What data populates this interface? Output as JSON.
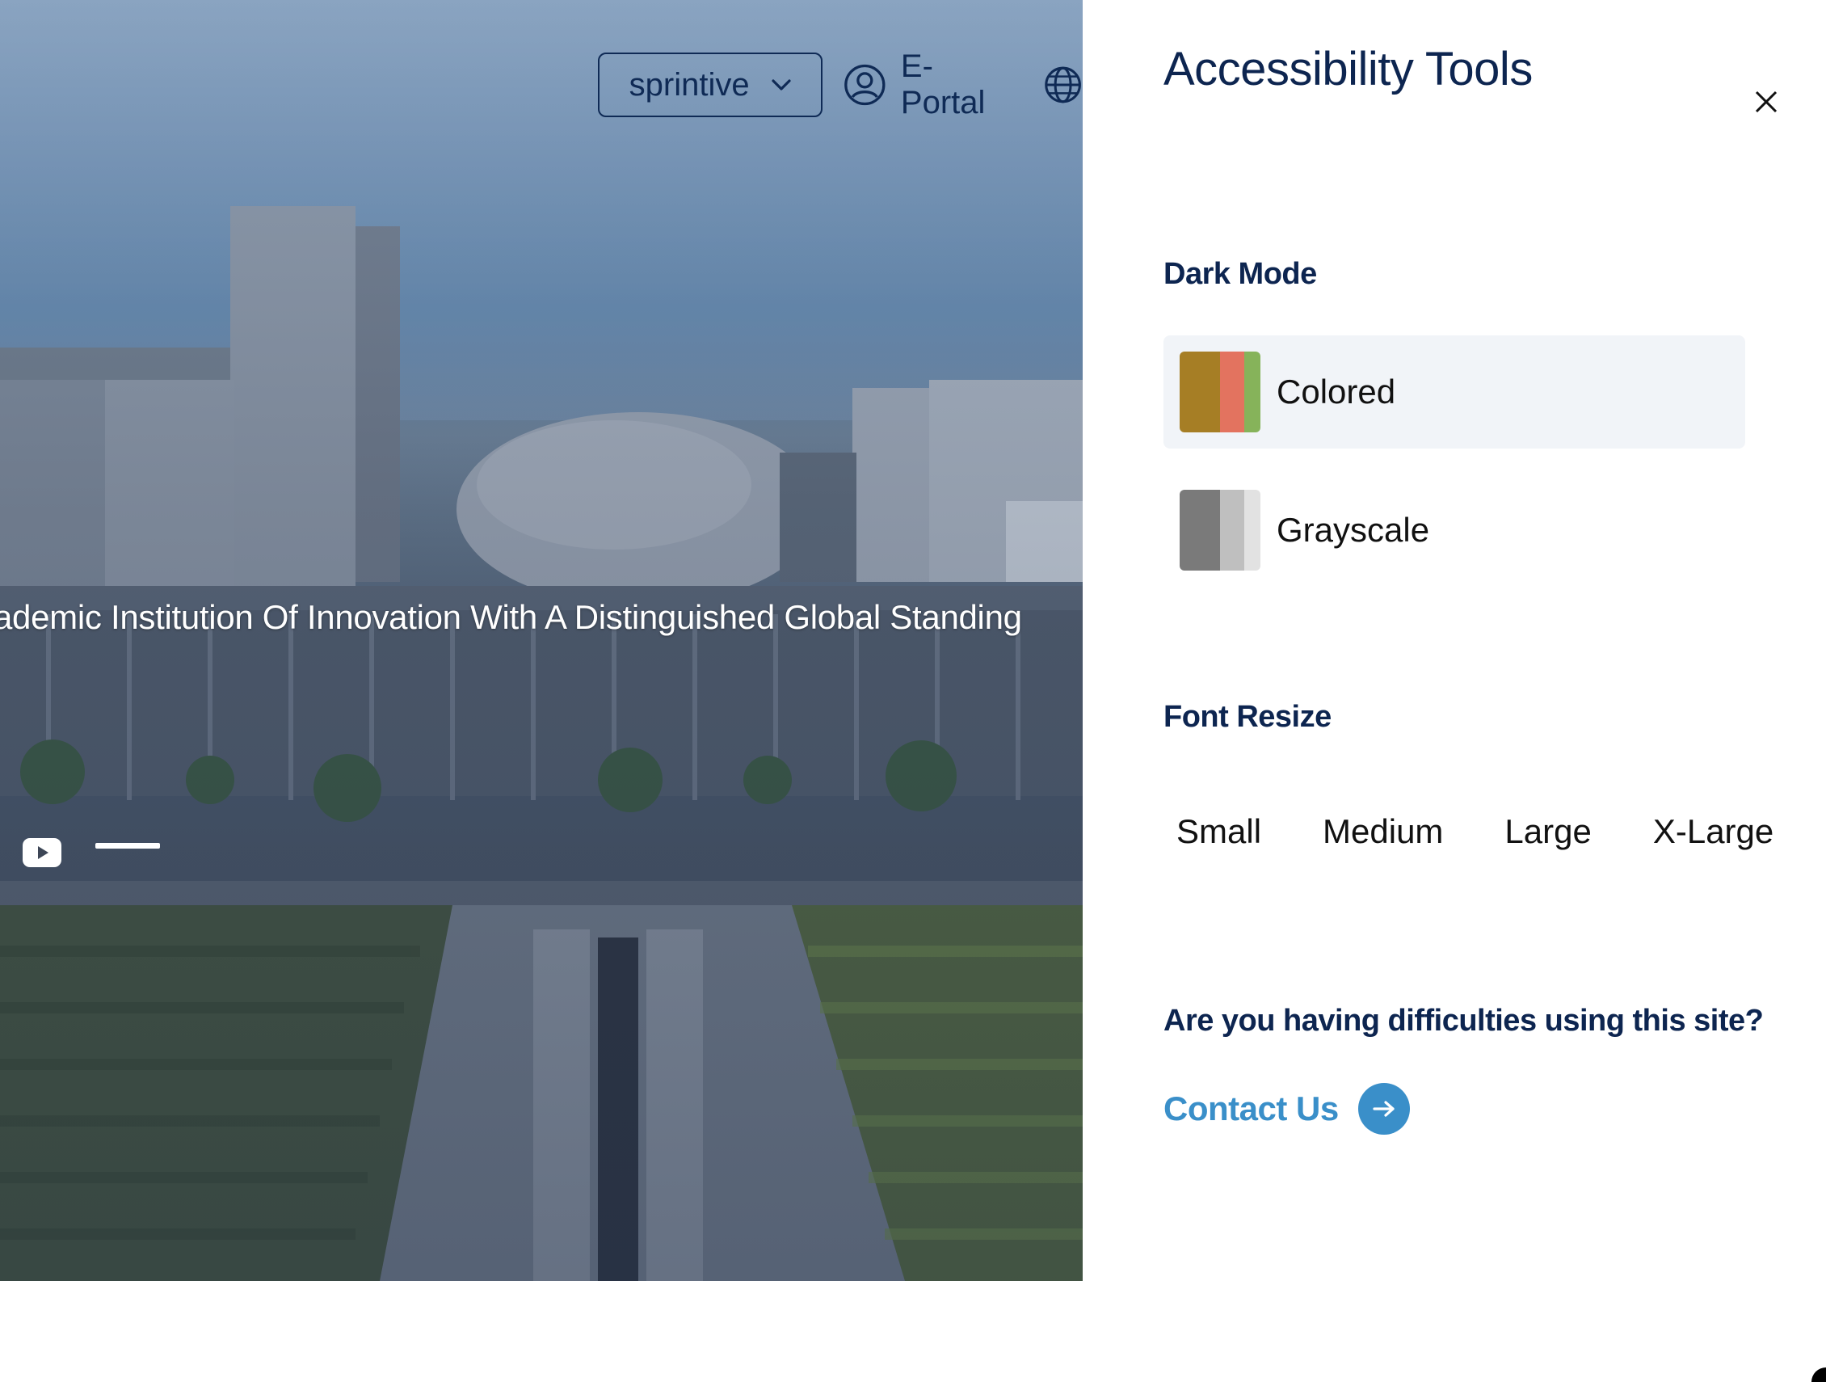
{
  "header": {
    "language_selector": {
      "value": "sprintive"
    },
    "portal_link": {
      "label": "E-Portal"
    }
  },
  "hero": {
    "tagline": "ademic Institution Of Innovation With A Distinguished Global Standing"
  },
  "accessibility_panel": {
    "title": "Accessibility Tools",
    "dark_mode": {
      "heading": "Dark Mode",
      "options": [
        {
          "label": "Colored",
          "selected": true,
          "swatch": [
            "#a67e25",
            "#e3735f",
            "#86b35a"
          ]
        },
        {
          "label": "Grayscale",
          "selected": false,
          "swatch": [
            "#7a7a7a",
            "#bfbfbf",
            "#e2e2e2"
          ]
        }
      ]
    },
    "font_resize": {
      "heading": "Font Resize",
      "options": [
        "Small",
        "Medium",
        "Large",
        "X-Large"
      ]
    },
    "help": {
      "question": "Are you having difficulties using this site?",
      "contact_label": "Contact Us"
    }
  },
  "colors": {
    "navy": "#0d2550",
    "accent_blue": "#3a8fc9",
    "selected_bg": "#f1f4f8"
  },
  "icons": [
    "chevron-down-icon",
    "user-circle-icon",
    "globe-icon",
    "close-icon",
    "youtube-icon",
    "arrow-right-icon"
  ]
}
